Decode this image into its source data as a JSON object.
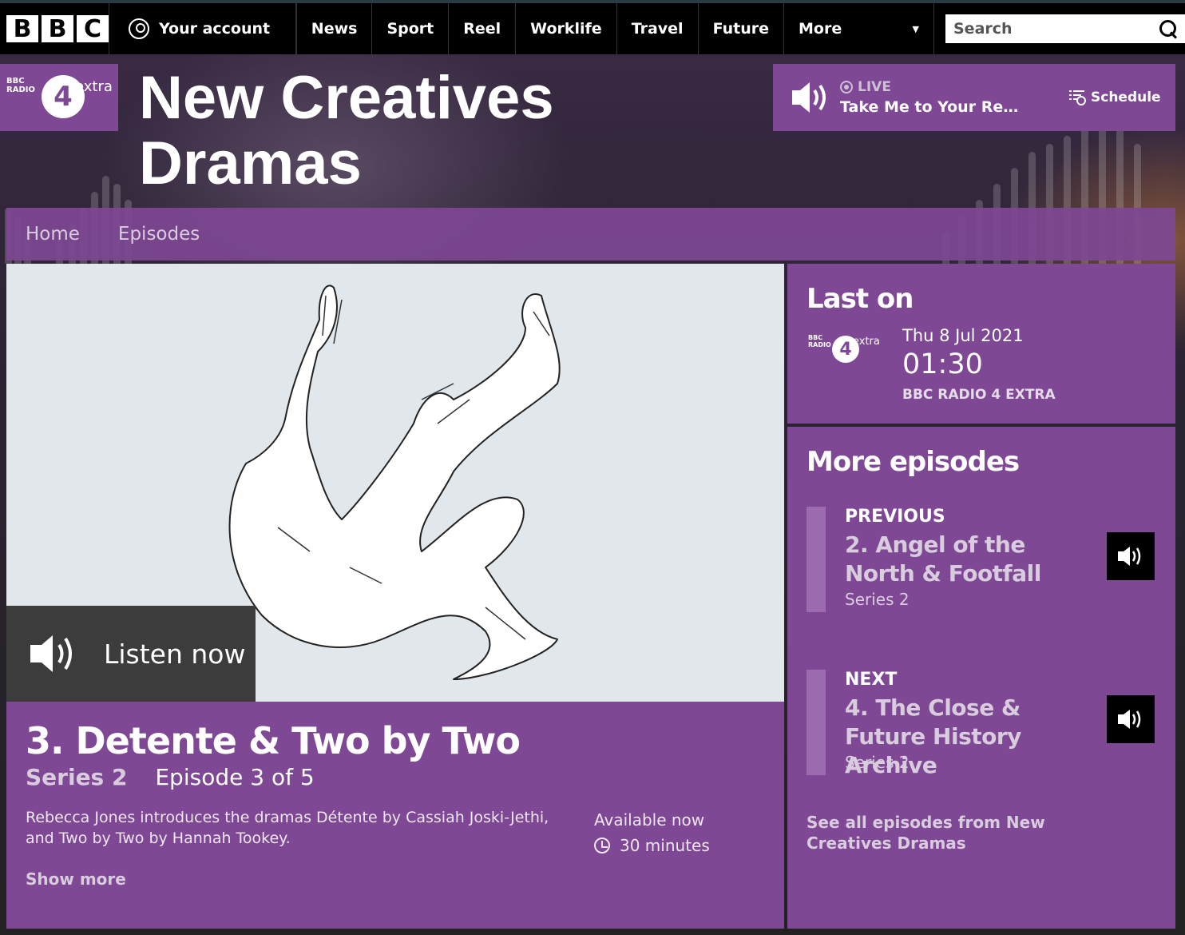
{
  "topnav": {
    "logo_letters": [
      "B",
      "B",
      "C"
    ],
    "account_label": "Your account",
    "items": [
      "News",
      "Sport",
      "Reel",
      "Worklife",
      "Travel",
      "Future"
    ],
    "more_label": "More",
    "search_placeholder": "Search"
  },
  "brand": {
    "logo_bbc": "BBC RADIO",
    "logo_number": "4",
    "logo_extra": "extra",
    "title_line1": "New Creatives",
    "title_line2": "Dramas"
  },
  "live": {
    "label": "LIVE",
    "now_playing": "Take Me to Your Rea...",
    "schedule_label": "Schedule"
  },
  "subnav": {
    "items": [
      "Home",
      "Episodes"
    ]
  },
  "episode": {
    "listen_label": "Listen now",
    "title": "3. Detente & Two by Two",
    "series": "Series 2",
    "episode_of": "Episode 3 of 5",
    "description": "Rebecca Jones introduces the dramas Détente by Cassiah Joski-Jethi, and Two by Two by Hannah Tookey.",
    "availability": "Available now",
    "duration": "30 minutes",
    "show_more": "Show more"
  },
  "last_on": {
    "heading": "Last on",
    "date": "Thu 8 Jul 2021",
    "time": "01:30",
    "channel": "BBC RADIO 4 EXTRA"
  },
  "more_episodes": {
    "heading": "More episodes",
    "previous": {
      "kind": "PREVIOUS",
      "title": "2. Angel of the North & Footfall",
      "series": "Series 2"
    },
    "next": {
      "kind": "NEXT",
      "title": "4. The Close & Future History Archive",
      "series": "Series 2"
    },
    "see_all": "See all episodes from New Creatives Dramas"
  },
  "colors": {
    "brand_purple": "#7e4894",
    "light_purple_text": "#d9ccdf",
    "nav_black": "#000000"
  }
}
